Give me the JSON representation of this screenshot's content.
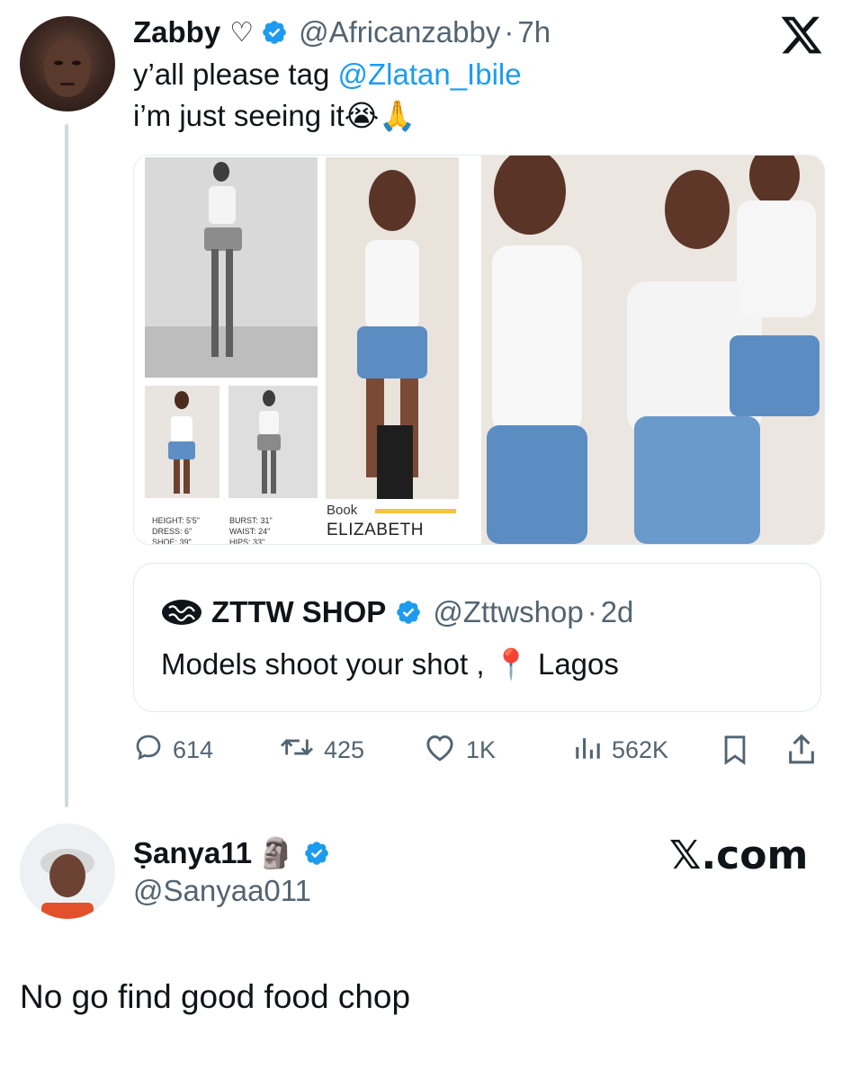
{
  "tweet": {
    "author_name": "Zabby",
    "heart_symbol": "♡",
    "handle": "@Africanzabby",
    "separator": "·",
    "time": "7h",
    "text_line1_prefix": "y’all please tag ",
    "mention": "@Zlatan_Ibile",
    "text_line2": "i’m just seeing it",
    "emojis": "😭🙏",
    "x_logo": "𝕏",
    "image": {
      "comp_card_stats": {
        "height": "HEIGHT: 5'5\"",
        "dress": "DRESS: 6\"",
        "shoe": "SHOE: 39\"",
        "burst": "BURST: 31\"",
        "waist": "WAIST: 24\"",
        "hips": "HIPS: 33\""
      },
      "book_label": "Book",
      "model_name": "ELIZABETH"
    },
    "quote": {
      "name": "ZTTW SHOP",
      "handle": "@Zttwshop",
      "separator": "·",
      "time": "2d",
      "text": "Models shoot your shot ,",
      "pin_emoji": "📍",
      "location": "Lagos"
    },
    "actions": {
      "replies": "614",
      "reposts": "425",
      "likes": "1K",
      "views": "562K"
    }
  },
  "reply": {
    "author_name": "Ṣanya11",
    "emoji": "🗿",
    "handle": "@Sanyaa011",
    "brand": "𝕏.com",
    "text": "No go find good food chop"
  },
  "colors": {
    "accent": "#1d9bf0",
    "muted": "#536471",
    "thread_line": "#cfd9de",
    "tag_bar": "#f5c242"
  },
  "icons": [
    "verified-badge-icon",
    "x-logo-icon",
    "reply-icon",
    "repost-icon",
    "like-icon",
    "views-icon",
    "bookmark-icon",
    "share-icon",
    "zttw-logo-icon"
  ]
}
